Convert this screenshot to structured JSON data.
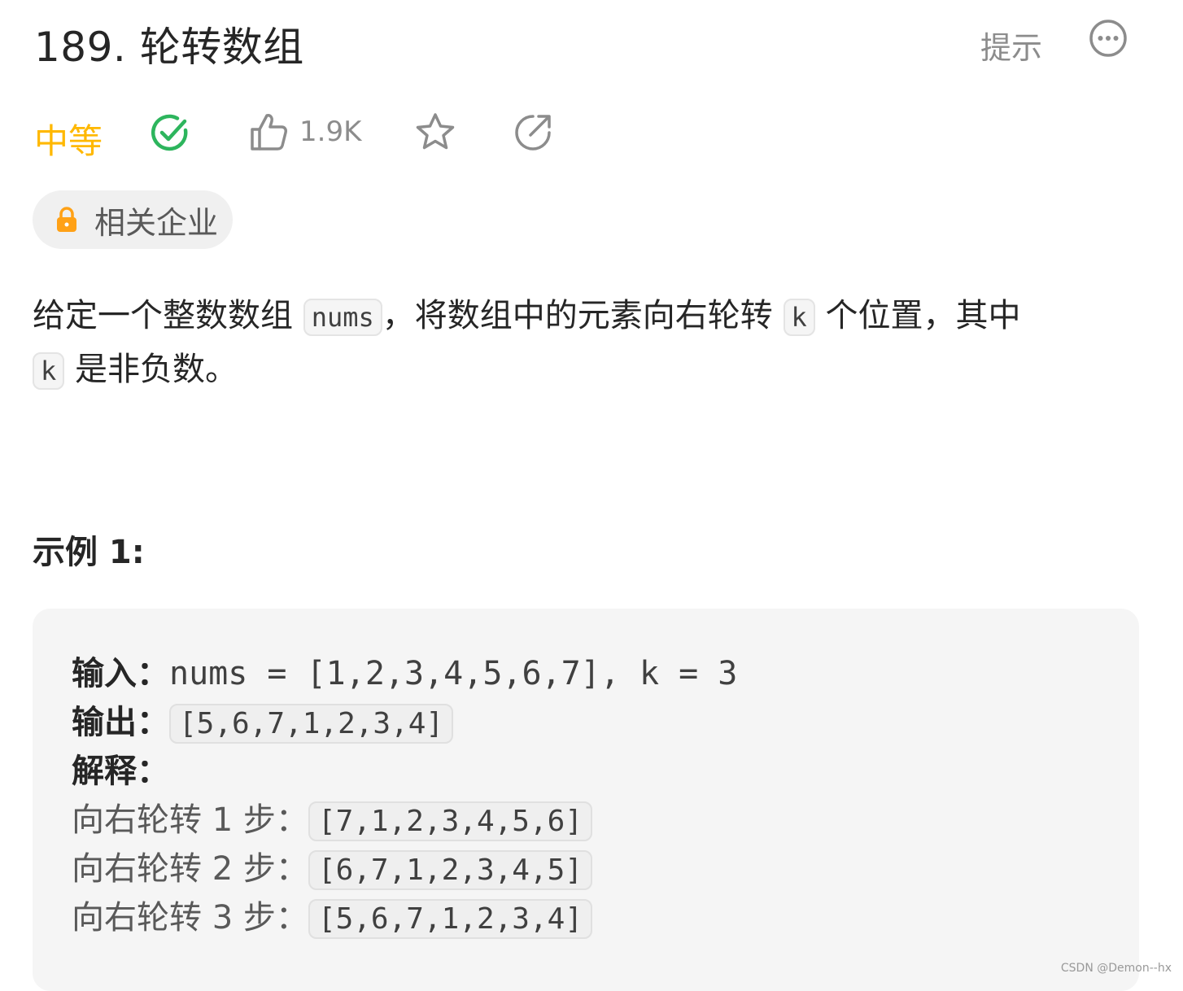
{
  "header": {
    "title": "189. 轮转数组",
    "hint_label": "提示"
  },
  "meta": {
    "difficulty": "中等",
    "likes": "1.9K"
  },
  "company": {
    "label": "相关企业"
  },
  "description": {
    "part1": "给定一个整数数组 ",
    "code1": "nums",
    "part2": "，将数组中的元素向右轮转 ",
    "code2": "k",
    "part3": " 个位置，其中 ",
    "code3": "k",
    "part4": " 是非负数。"
  },
  "example": {
    "heading": "示例 1:",
    "input_label": "输入：",
    "input_value": "nums = [1,2,3,4,5,6,7], k = 3",
    "output_label": "输出：",
    "output_value": "[5,6,7,1,2,3,4]",
    "explanation_label": "解释：",
    "steps": [
      {
        "text": "向右轮转 1 步：",
        "value": "[7,1,2,3,4,5,6]"
      },
      {
        "text": "向右轮转 2 步：",
        "value": "[6,7,1,2,3,4,5]"
      },
      {
        "text": "向右轮转 3 步：",
        "value": "[5,6,7,1,2,3,4]"
      }
    ]
  },
  "watermark": "CSDN @Demon--hx",
  "colors": {
    "difficulty_medium": "#ffb800",
    "solved_green": "#2db55d",
    "lock_orange": "#ffa116"
  },
  "icons": {
    "more": "more-horizontal-icon",
    "solved": "check-circle-icon",
    "like": "thumbs-up-icon",
    "star": "star-icon",
    "share": "share-icon",
    "lock": "lock-icon"
  }
}
